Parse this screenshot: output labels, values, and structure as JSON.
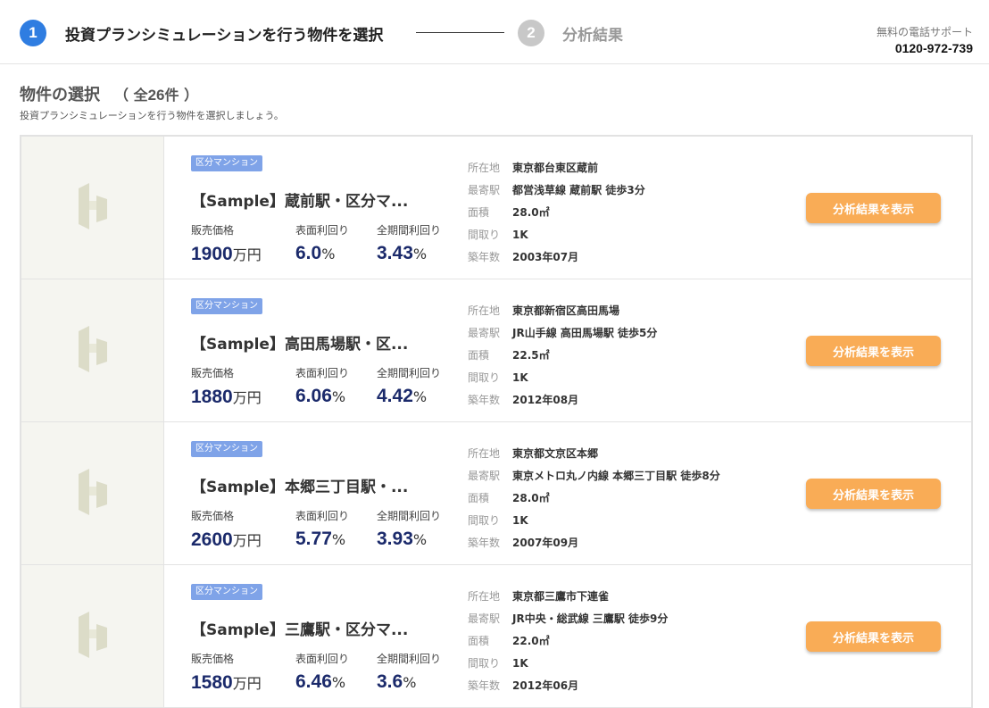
{
  "header": {
    "step1": {
      "number": "1",
      "label": "投資プランシミュレーションを行う物件を選択"
    },
    "step2": {
      "number": "2",
      "label": "分析結果"
    },
    "support": {
      "label": "無料の電話サポート",
      "phone": "0120-972-739"
    }
  },
  "section": {
    "title": "物件の選択",
    "count_prefix": "（ 全",
    "count": "26",
    "count_suffix": "件 ）",
    "subtitle": "投資プランシミュレーションを行う物件を選択しましょう。"
  },
  "labels": {
    "price": "販売価格",
    "surface_yield": "表面利回り",
    "total_yield": "全期間利回り",
    "address": "所在地",
    "station": "最寄駅",
    "area": "面積",
    "layout": "間取り",
    "age": "築年数",
    "price_unit": "万円",
    "percent": "%",
    "button": "分析結果を表示"
  },
  "thumbnail_icon": "building-placeholder-icon",
  "colors": {
    "accent": "#2f7de1",
    "button": "#f9ac56",
    "value": "#1b2a6b",
    "badge": "#7fa3e8"
  },
  "properties": [
    {
      "badge": "区分マンション",
      "name": "【Sample】蔵前駅・区分マ...",
      "price": "1900",
      "surface_yield": "6.0",
      "total_yield": "3.43",
      "address": "東京都台東区蔵前",
      "station": "都営浅草線 蔵前駅 徒歩3分",
      "area": "28.0㎡",
      "layout": "1K",
      "built": "2003年07月"
    },
    {
      "badge": "区分マンション",
      "name": "【Sample】高田馬場駅・区...",
      "price": "1880",
      "surface_yield": "6.06",
      "total_yield": "4.42",
      "address": "東京都新宿区高田馬場",
      "station": "JR山手線 高田馬場駅 徒歩5分",
      "area": "22.5㎡",
      "layout": "1K",
      "built": "2012年08月"
    },
    {
      "badge": "区分マンション",
      "name": "【Sample】本郷三丁目駅・...",
      "price": "2600",
      "surface_yield": "5.77",
      "total_yield": "3.93",
      "address": "東京都文京区本郷",
      "station": "東京メトロ丸ノ内線 本郷三丁目駅 徒歩8分",
      "area": "28.0㎡",
      "layout": "1K",
      "built": "2007年09月"
    },
    {
      "badge": "区分マンション",
      "name": "【Sample】三鷹駅・区分マ...",
      "price": "1580",
      "surface_yield": "6.46",
      "total_yield": "3.6",
      "address": "東京都三鷹市下連雀",
      "station": "JR中央・総武線 三鷹駅 徒歩9分",
      "area": "22.0㎡",
      "layout": "1K",
      "built": "2012年06月"
    }
  ]
}
